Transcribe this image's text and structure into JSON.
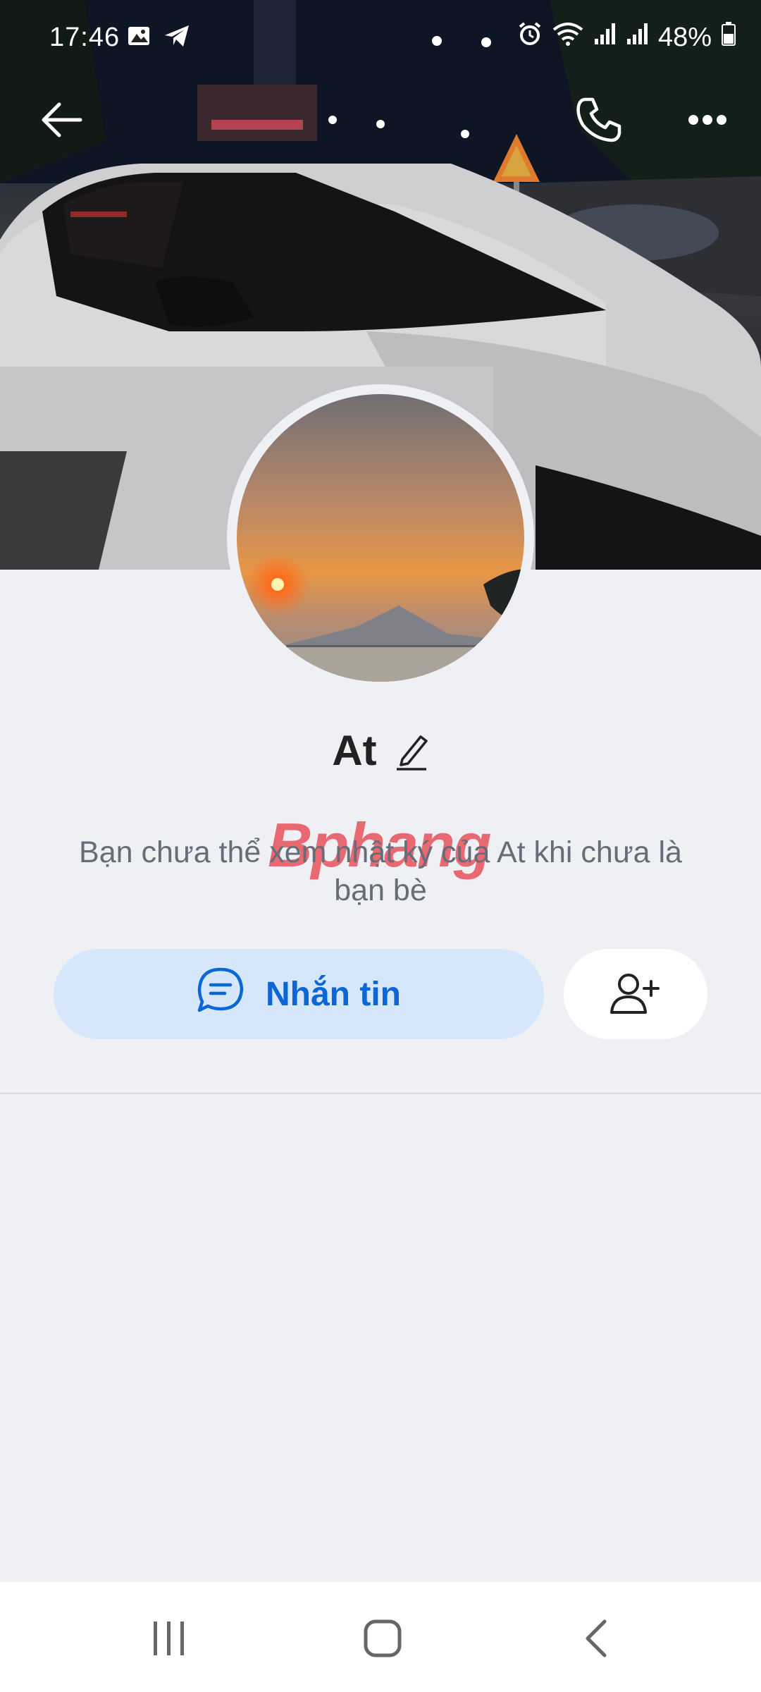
{
  "status_bar": {
    "time": "17:46",
    "battery": "48%",
    "left_icons": [
      "gallery-icon",
      "telegram-icon"
    ],
    "right_icons": [
      "alarm-icon",
      "wifi-icon",
      "signal-icon",
      "signal-icon"
    ]
  },
  "top_bar": {
    "icons": [
      "back-arrow-icon",
      "phone-icon",
      "more-icon"
    ]
  },
  "profile": {
    "name": "At",
    "info_text": "Bạn chưa thể xem nhật ký của At khi chưa là bạn bè",
    "watermark": "Bphang"
  },
  "actions": {
    "message_label": "Nhắn tin",
    "message_icon": "chat-bubble-icon",
    "add_friend_icon": "add-friend-icon"
  },
  "colors": {
    "accent": "#0b67d8",
    "message_bg": "#d7e7fb",
    "page_bg": "#eff0f4"
  },
  "nav_bar": {
    "icons": [
      "recent-apps-icon",
      "home-icon",
      "back-icon"
    ]
  }
}
